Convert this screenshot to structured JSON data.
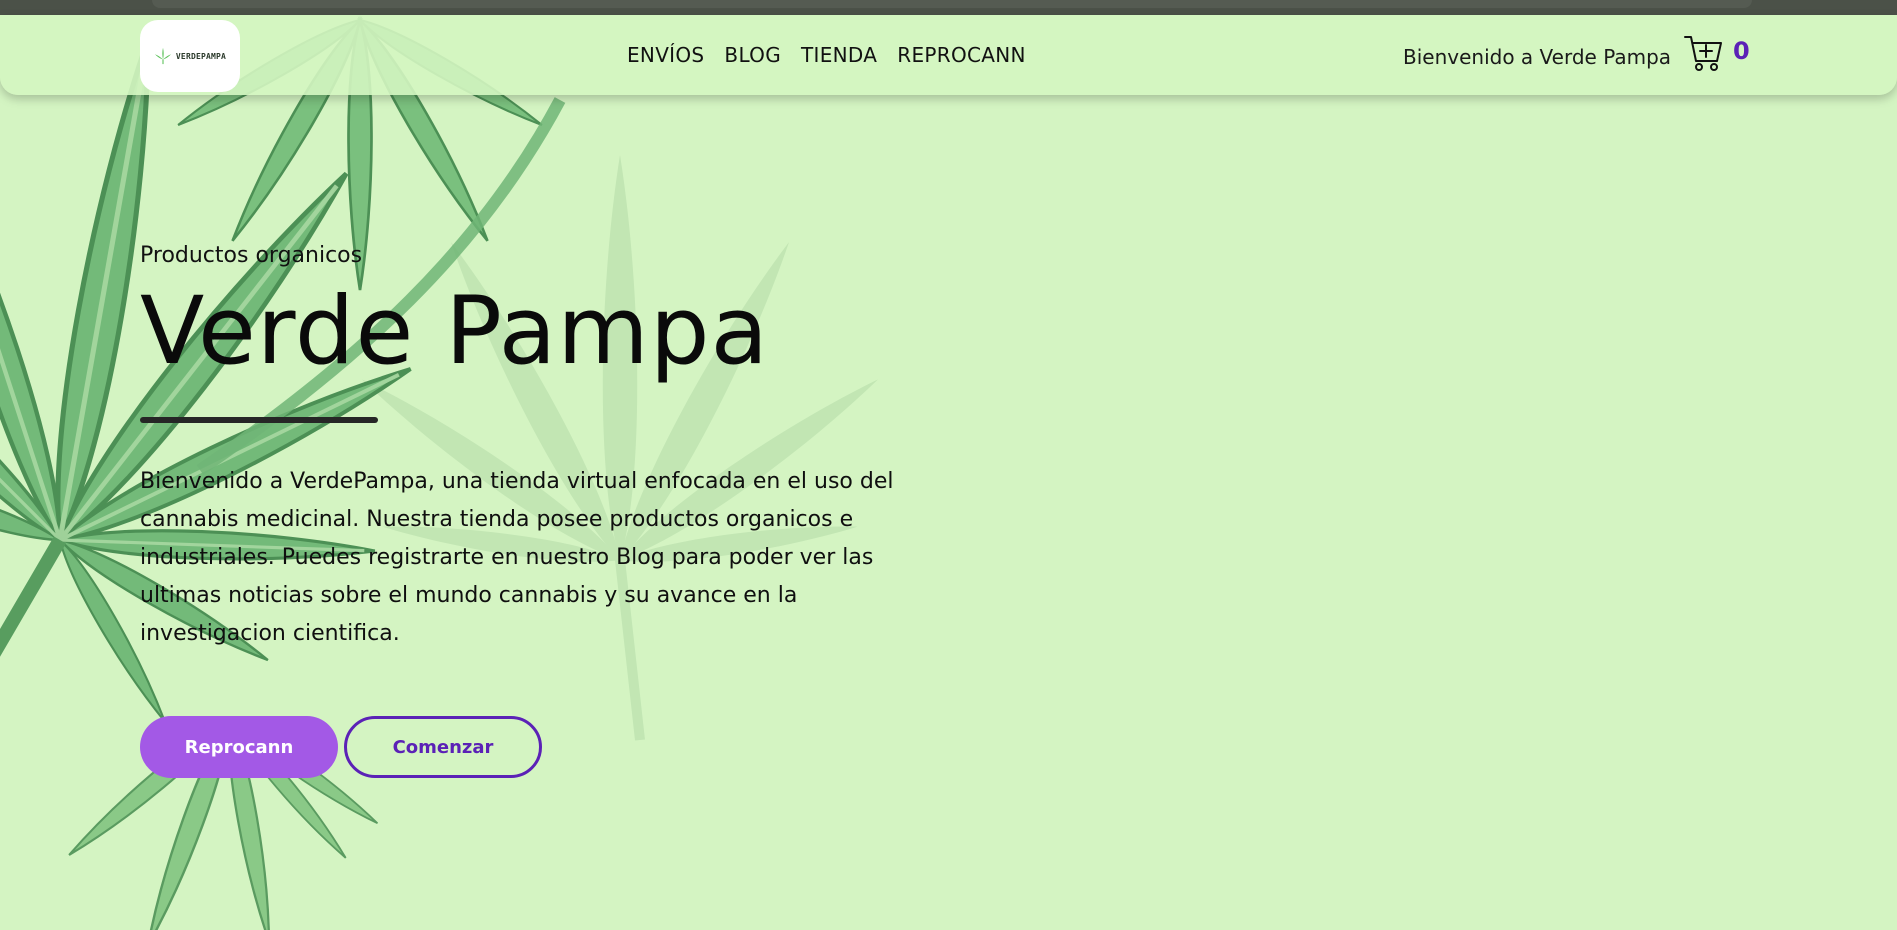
{
  "browser": {
    "chrome": "dark-top-bar"
  },
  "header": {
    "logo_text": "VERDEPAMPA",
    "logo_icon": "cannabis-leaf-icon",
    "nav": [
      {
        "label": "ENVÍOS"
      },
      {
        "label": "BLOG"
      },
      {
        "label": "TIENDA"
      },
      {
        "label": "REPROCANN"
      }
    ],
    "welcome": "Bienvenido a Verde Pampa",
    "cart": {
      "icon": "cart-add-icon",
      "count": "0"
    }
  },
  "hero": {
    "eyebrow": "Productos organicos",
    "title": "Verde Pampa",
    "description": "Bienvenido a VerdePampa, una tienda virtual enfocada en el uso del cannabis medicinal. Nuestra tienda posee productos organicos e industriales. Puedes registrarte en nuestro Blog para poder ver las ultimas noticias sobre el mundo cannabis y su avance en la investigacion cientifica.",
    "primary_button": "Reprocann",
    "secondary_button": "Comenzar"
  },
  "colors": {
    "background": "#d5f5c3",
    "accent_purple": "#a359e6",
    "deep_purple": "#5b21b6",
    "leaf_green": "#4a9a5a"
  }
}
